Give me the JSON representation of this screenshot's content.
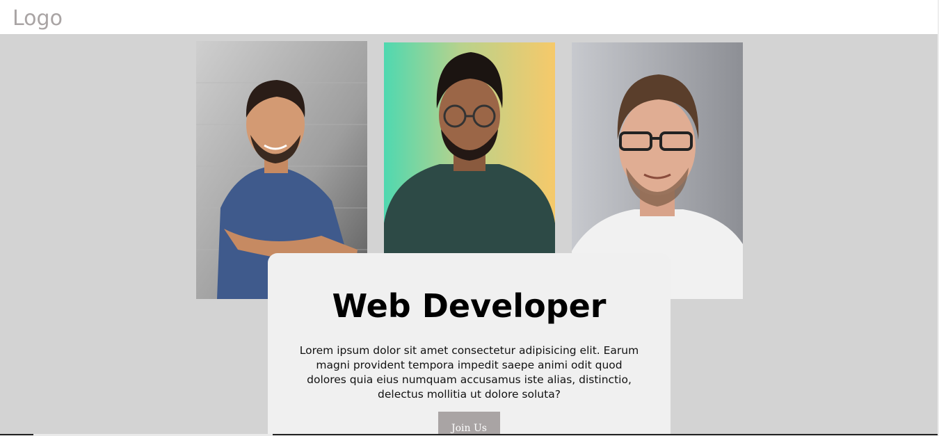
{
  "header": {
    "logo_text": "Logo"
  },
  "photos": [
    {
      "alt": "smiling man in blue shirt"
    },
    {
      "alt": "man with glasses in green shirt"
    },
    {
      "alt": "smiling man with glasses in white shirt"
    }
  ],
  "card": {
    "title": "Web Developer",
    "body": "Lorem ipsum dolor sit amet consectetur adipisicing elit. Earum magni provident tempora impedit saepe animi odit quod dolores quia eius numquam accusamus iste alias, distinctio, delectus mollitia ut dolore soluta?",
    "button_label": "Join Us"
  },
  "colors": {
    "page_bg": "#d3d3d3",
    "header_bg": "#ffffff",
    "logo": "#a9a4a4",
    "card_bg": "#f0f0f0",
    "button_bg": "#a9a4a4"
  }
}
